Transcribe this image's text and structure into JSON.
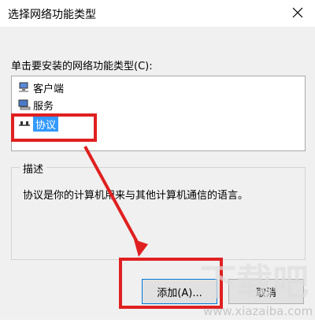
{
  "window": {
    "title": "选择网络功能类型"
  },
  "prompt": "单击要安装的网络功能类型(C):",
  "list": {
    "items": [
      {
        "label": "客户端",
        "icon": "client-icon",
        "selected": false
      },
      {
        "label": "服务",
        "icon": "service-icon",
        "selected": false
      },
      {
        "label": "协议",
        "icon": "protocol-icon",
        "selected": true
      }
    ]
  },
  "description": {
    "title": "描述",
    "text": "协议是你的计算机用来与其他计算机通信的语言。"
  },
  "buttons": {
    "add": "添加(A)...",
    "cancel": "取消"
  },
  "watermark": {
    "text": "下载吧",
    "url": "www.xiazaiba.com"
  },
  "colors": {
    "annotation": "#e02020",
    "selection": "#3399ff"
  }
}
